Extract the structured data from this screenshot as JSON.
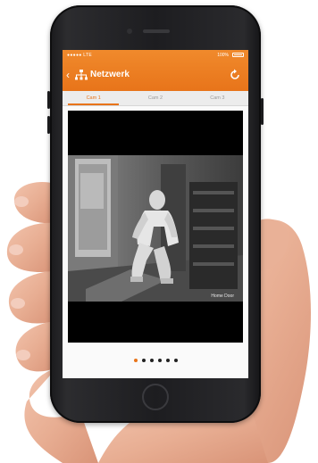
{
  "status_bar": {
    "carrier": "●●●●● LTE",
    "battery": "100%"
  },
  "header": {
    "back_icon": "chevron-left-icon",
    "network_icon": "network-icon",
    "title": "Netzwerk",
    "refresh_icon": "refresh-icon"
  },
  "tabs": [
    {
      "label": "Cam 1",
      "active": true
    },
    {
      "label": "Cam 2",
      "active": false
    },
    {
      "label": "Cam 3",
      "active": false
    }
  ],
  "video": {
    "timestamp": "Home Door"
  },
  "pager": {
    "count": 6,
    "active_index": 0
  },
  "colors": {
    "accent": "#e8741a",
    "header_top": "#f08a2c",
    "tab_bg": "#ececec"
  }
}
